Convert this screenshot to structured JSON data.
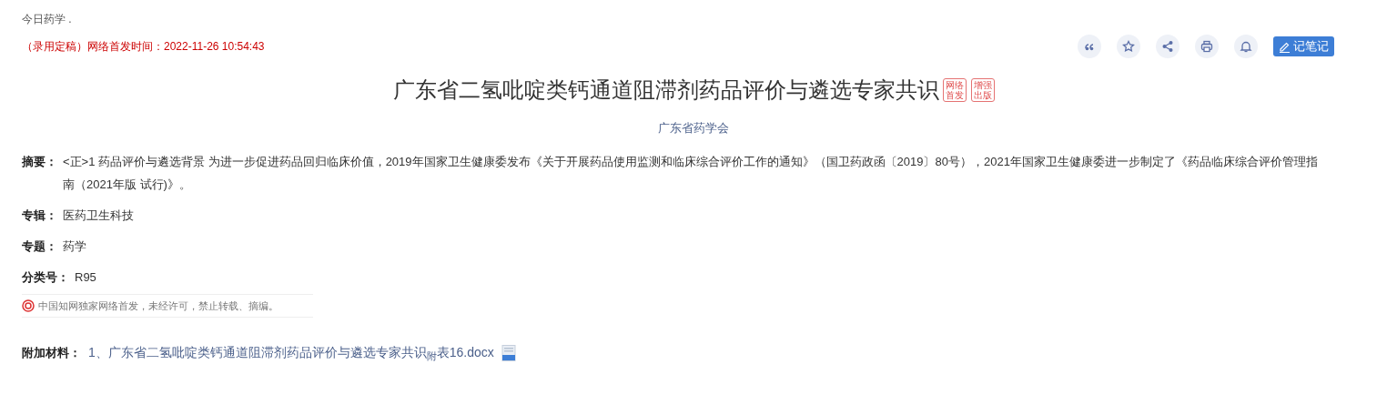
{
  "breadcrumb": "今日药学 .",
  "publish_note": "（录用定稿）网络首发时间：2022-11-26 10:54:43",
  "toolbar": {
    "icons": [
      {
        "kind": "quote"
      },
      {
        "kind": "star"
      },
      {
        "kind": "share"
      },
      {
        "kind": "print"
      },
      {
        "kind": "bell"
      }
    ],
    "note_button": "记笔记"
  },
  "title": "广东省二氢吡啶类钙通道阻滞剂药品评价与遴选专家共识",
  "badges": [
    {
      "lines": [
        "网络",
        "首发"
      ]
    },
    {
      "lines": [
        "增强",
        "出版"
      ]
    }
  ],
  "author": "广东省药学会",
  "fields": [
    {
      "label": "摘要：",
      "value": "<正>1 药品评价与遴选背景 为进一步促进药品回归临床价值，2019年国家卫生健康委发布《关于开展药品使用监测和临床综合评价工作的通知》（国卫药政函〔2019〕80号），2021年国家卫生健康委进一步制定了《药品临床综合评价管理指南（2021年版 试行)》。"
    },
    {
      "label": "专辑：",
      "value": "医药卫生科技"
    },
    {
      "label": "专题：",
      "value": "药学"
    },
    {
      "label": "分类号：",
      "value": "R95"
    }
  ],
  "copyright": "中国知网独家网络首发，未经许可，禁止转载、摘编。",
  "attachment": {
    "label": "附加材料：",
    "file": "1、广东省二氢吡啶类钙通道阻滞剂药品评价与遴选专家共识$_{附}$表16.docx"
  }
}
